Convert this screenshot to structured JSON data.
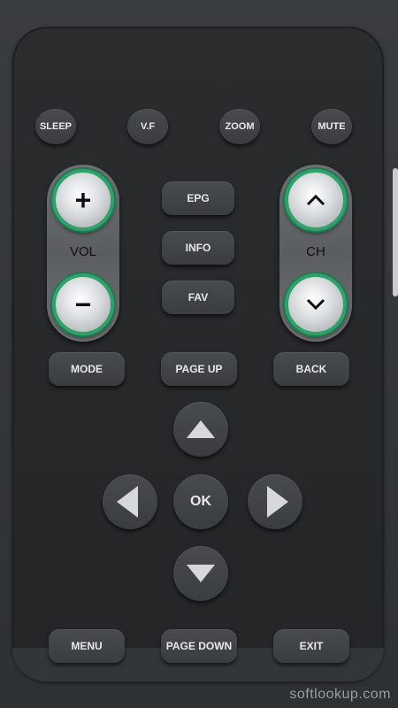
{
  "top_buttons": [
    "SLEEP",
    "V.F",
    "ZOOM",
    "MUTE"
  ],
  "volume": {
    "label": "VOL",
    "up_symbol": "+",
    "down_symbol": "−"
  },
  "channel": {
    "label": "CH",
    "up_symbol": "^",
    "down_symbol": "v"
  },
  "center_buttons": [
    "EPG",
    "INFO",
    "FAV"
  ],
  "row_buttons": {
    "mode": "MODE",
    "page_up": "PAGE UP",
    "back": "BACK"
  },
  "dpad": {
    "ok": "OK"
  },
  "bottom_buttons": {
    "menu": "MENU",
    "page_down": "PAGE DOWN",
    "exit": "EXIT"
  },
  "watermark": "softlookup.com",
  "colors": {
    "accent_ring": "#2fa16b",
    "panel": "#232527"
  },
  "icons": {
    "up": "triangle-up-icon",
    "down": "triangle-down-icon",
    "left": "triangle-left-icon",
    "right": "triangle-right-icon"
  }
}
